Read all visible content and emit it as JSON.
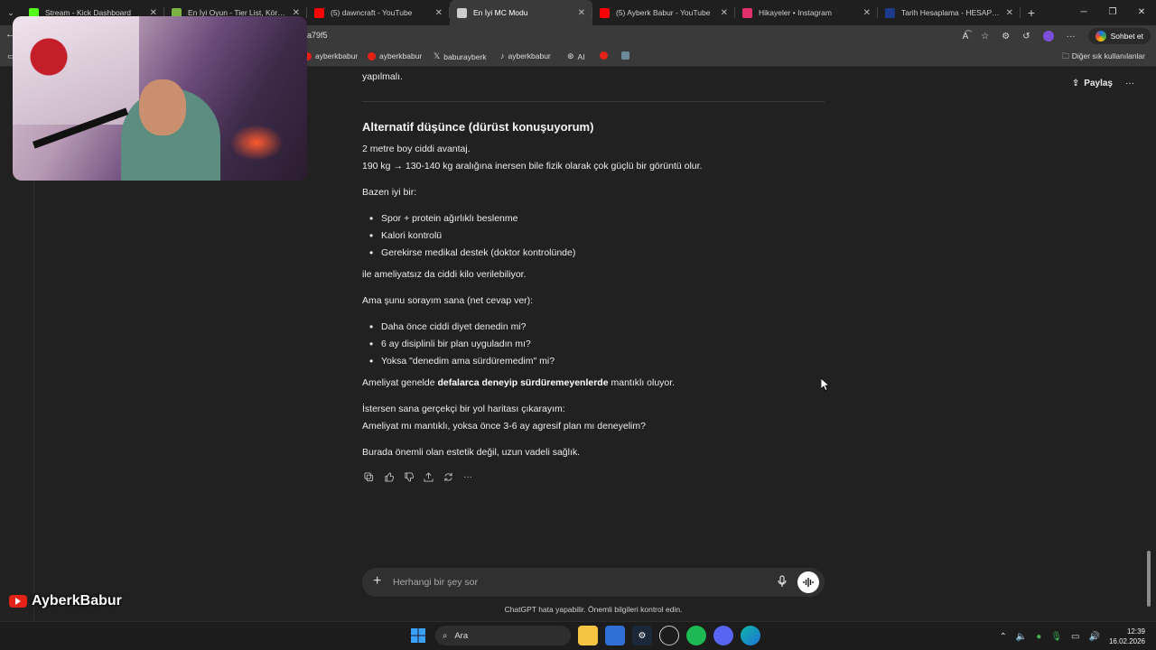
{
  "browser": {
    "tabs": [
      {
        "title": "Stream - Kick Dashboard",
        "icon": "kick-icon",
        "color": "#53fc18"
      },
      {
        "title": "En İyi Oyun - Tier List, Kör Sıralam...",
        "icon": "tierlist-icon",
        "color": "#7cb342"
      },
      {
        "title": "(5) dawncraft - YouTube",
        "icon": "youtube-icon",
        "color": "#ff0000"
      },
      {
        "title": "En İyi MC Modu",
        "icon": "chatgpt-icon",
        "color": "#cccccc",
        "active": true
      },
      {
        "title": "(5) Ayberk Babur - YouTube",
        "icon": "youtube-icon",
        "color": "#ff0000"
      },
      {
        "title": "Hikayeler • Instagram",
        "icon": "instagram-icon",
        "color": "#e1306c"
      },
      {
        "title": "Tarih Hesaplama - HESAPLAMA.N...",
        "icon": "hesaplama-icon",
        "color": "#1e3a8a"
      }
    ],
    "url": "a79f5",
    "chat_button": "Sohbet et",
    "bookmarks": [
      {
        "label": "ayberkbabur",
        "icon": "youtube-icon"
      },
      {
        "label": "ayberkbabur",
        "icon": "youtube-icon"
      },
      {
        "label": "baburayberk",
        "icon": "x-icon"
      },
      {
        "label": "ayberkbabur",
        "icon": "tiktok-icon"
      },
      {
        "label": "AI",
        "icon": "chatgpt-icon"
      }
    ],
    "other_bookmarks": "Diğer sık kullanılanlar"
  },
  "page": {
    "share_label": "Paylaş",
    "prev_tail": "yapılmalı.",
    "heading": "Alternatif düşünce (dürüst konuşuyorum)",
    "p1": "2 metre boy ciddi avantaj.",
    "p2": "190 kg → 130-140 kg aralığına inersen bile fizik olarak çok güçlü bir görüntü olur.",
    "p3": "Bazen iyi bir:",
    "list1": [
      "Spor + protein ağırlıklı beslenme",
      "Kalori kontrolü",
      "Gerekirse medikal destek (doktor kontrolünde)"
    ],
    "p4": "ile ameliyatsız da ciddi kilo verilebiliyor.",
    "p5": "Ama şunu sorayım sana (net cevap ver):",
    "list2": [
      "Daha önce ciddi diyet denedin mi?",
      "6 ay disiplinli bir plan uyguladın mı?",
      "Yoksa \"denedim ama sürdüremedim\" mi?"
    ],
    "p6_pre": "Ameliyat genelde ",
    "p6_bold": "defalarca deneyip sürdüremeyenlerde",
    "p6_post": " mantıklı oluyor.",
    "p7": "İstersen sana gerçekçi bir yol haritası çıkarayım:",
    "p8": "Ameliyat mı mantıklı, yoksa önce 3-6 ay agresif plan mı deneyelim?",
    "p9": "Burada önemli olan estetik değil, uzun vadeli sağlık.",
    "composer_placeholder": "Herhangi bir şey sor",
    "disclaimer": "ChatGPT hata yapabilir. Önemli bilgileri kontrol edin."
  },
  "overlay": {
    "streamer_name": "AyberkBabur"
  },
  "taskbar": {
    "search_label": "Ara",
    "time": "12:39",
    "date": "16.02.2026"
  }
}
